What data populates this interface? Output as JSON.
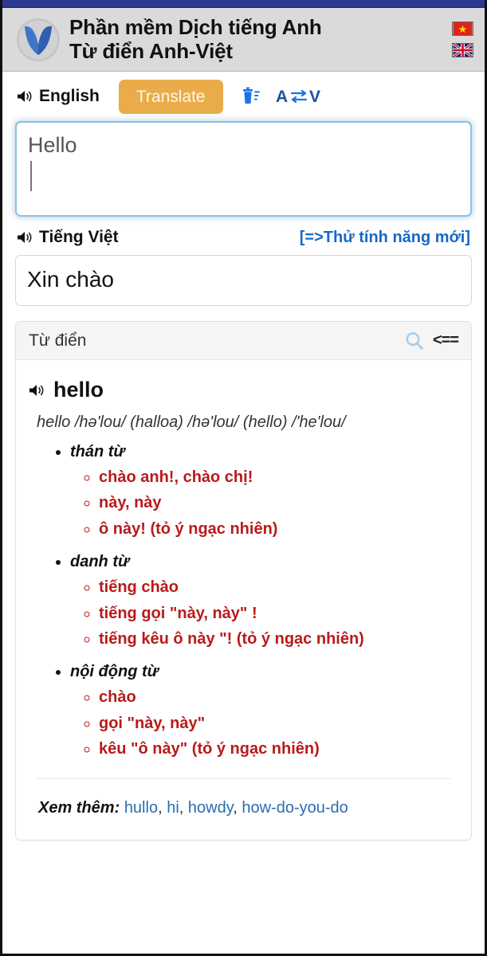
{
  "header": {
    "logo_icon": "v-tulip-logo-icon",
    "title_line1": "Phần mềm Dịch tiếng Anh",
    "title_line2": "Từ điển Anh-Việt",
    "flags": [
      {
        "name": "vietnam-flag-icon",
        "label": "Tiếng Việt"
      },
      {
        "name": "uk-flag-icon",
        "label": "English"
      }
    ]
  },
  "toolbar": {
    "source_language": "English",
    "speaker_icon": "speaker-icon",
    "translate_label": "Translate",
    "clear_icon": "trash-clear-icon",
    "swap_icon": "swap-languages-icon",
    "swap_from": "A",
    "swap_to": "V"
  },
  "source": {
    "text": "Hello",
    "placeholder": "Hello"
  },
  "target": {
    "language": "Tiếng Việt",
    "speaker_icon": "speaker-icon",
    "new_feature_link": "[=>Thử tính năng mới]",
    "text": "Xin chào"
  },
  "dictionary": {
    "panel_title": "Từ điển",
    "search_icon": "search-icon",
    "back_label": "<==",
    "entry": {
      "word": "hello",
      "speaker_icon": "speaker-icon",
      "phonetic": "hello /hə'lou/ (halloa) /hə'lou/ (hello) /'he'lou/",
      "parts_of_speech": [
        {
          "pos": "thán từ",
          "senses": [
            "chào anh!, chào chị!",
            "này, này",
            "ô này! (tỏ ý ngạc nhiên)"
          ]
        },
        {
          "pos": "danh từ",
          "senses": [
            "tiếng chào",
            "tiếng gọi \"này, này\" !",
            "tiếng kêu ô này \"! (tỏ ý ngạc nhiên)"
          ]
        },
        {
          "pos": "nội động từ",
          "senses": [
            "chào",
            "gọi \"này, này\"",
            "kêu \"ô này\" (tỏ ý ngạc nhiên)"
          ]
        }
      ]
    },
    "see_also": {
      "label": "Xem thêm:",
      "links": [
        "hullo",
        "hi",
        "howdy",
        "how-do-you-do"
      ]
    }
  },
  "colors": {
    "topbar": "#2b3990",
    "header_bg": "#dadada",
    "translate_btn": "#eaac4a",
    "link_blue": "#2b6cb0",
    "accent_blue": "#1469c7",
    "sense_red": "#b91a1a"
  }
}
